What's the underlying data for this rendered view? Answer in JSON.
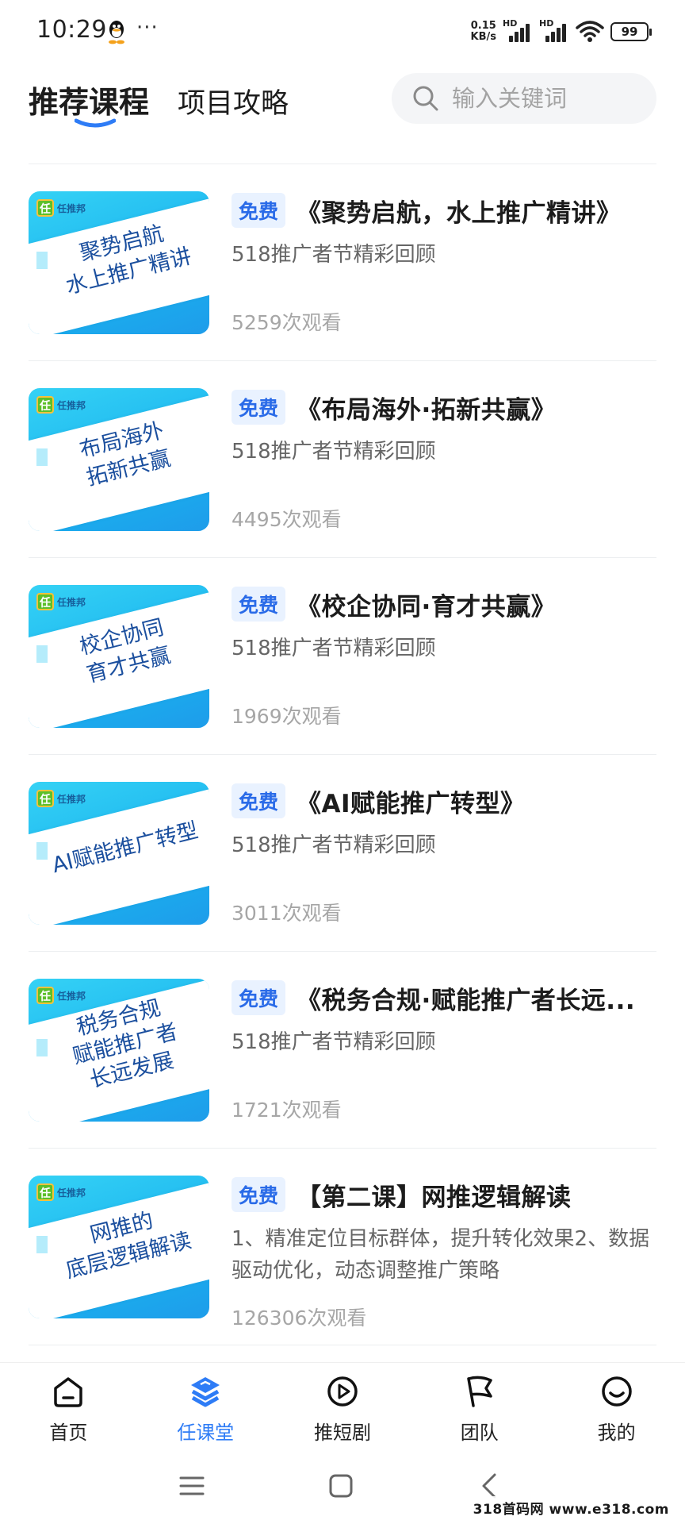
{
  "status_bar": {
    "time": "10:29",
    "dots": "···",
    "net_speed_value": "0.15",
    "net_speed_unit": "KB/s",
    "hd_label_1": "HD",
    "hd_label_2": "HD",
    "battery": "99"
  },
  "header": {
    "tabs": [
      {
        "label": "推荐课程",
        "active": true
      },
      {
        "label": "项目攻略",
        "active": false
      }
    ],
    "search_placeholder": "输入关键词"
  },
  "course_thumb": {
    "logo_badge": "任",
    "logo_brand": "任推邦"
  },
  "courses": [
    {
      "thumb_line1": "聚势启航",
      "thumb_line2": "水上推广精讲",
      "thumb_line3": "",
      "tag": "免费",
      "title": "《聚势启航，水上推广精讲》",
      "subtitle": "518推广者节精彩回顾",
      "views": "5259次观看"
    },
    {
      "thumb_line1": "布局海外",
      "thumb_line2": "拓新共赢",
      "thumb_line3": "",
      "tag": "免费",
      "title": "《布局海外·拓新共赢》",
      "subtitle": "518推广者节精彩回顾",
      "views": "4495次观看"
    },
    {
      "thumb_line1": "校企协同",
      "thumb_line2": "育才共赢",
      "thumb_line3": "",
      "tag": "免费",
      "title": "《校企协同·育才共赢》",
      "subtitle": "518推广者节精彩回顾",
      "views": "1969次观看"
    },
    {
      "thumb_line1": "AI赋能推广转型",
      "thumb_line2": "",
      "thumb_line3": "",
      "tag": "免费",
      "title": "《AI赋能推广转型》",
      "subtitle": "518推广者节精彩回顾",
      "views": "3011次观看"
    },
    {
      "thumb_line1": "税务合规",
      "thumb_line2": "赋能推广者",
      "thumb_line3": "长远发展",
      "tag": "免费",
      "title": "《税务合规·赋能推广者长远...",
      "subtitle": "518推广者节精彩回顾",
      "views": "1721次观看"
    },
    {
      "thumb_line1": "网推的",
      "thumb_line2": "底层逻辑解读",
      "thumb_line3": "",
      "tag": "免费",
      "title": "【第二课】网推逻辑解读",
      "subtitle": "1、精准定位目标群体，提升转化效果2、数据驱动优化，动态调整推广策略",
      "views": "126306次观看"
    }
  ],
  "bottom_nav": [
    {
      "label": "首页",
      "icon": "home-icon",
      "active": false
    },
    {
      "label": "任课堂",
      "icon": "layers-icon",
      "active": true
    },
    {
      "label": "推短剧",
      "icon": "play-circle-icon",
      "active": false
    },
    {
      "label": "团队",
      "icon": "flag-icon",
      "active": false
    },
    {
      "label": "我的",
      "icon": "smile-icon",
      "active": false
    }
  ],
  "colors": {
    "accent": "#2e7cf6",
    "free_tag_bg": "#e9f2ff",
    "free_tag_text": "#2a6be8",
    "thumb_blue": "#1ab2ef"
  },
  "watermark": "318首码网 www.e318.com"
}
